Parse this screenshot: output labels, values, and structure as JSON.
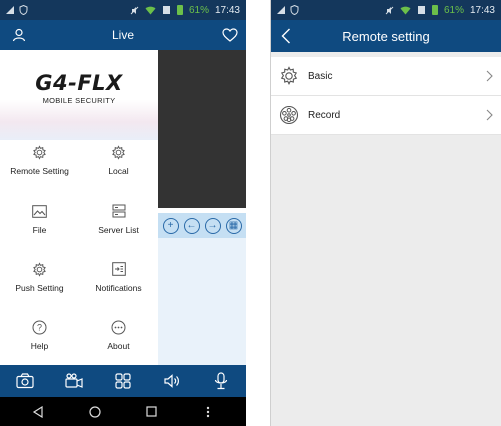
{
  "left_screen": {
    "status_bar": {
      "battery": "61%",
      "time": "17:43"
    },
    "app_bar": {
      "title": "Live",
      "left_icon": "user-icon",
      "right_icon": "heart-icon"
    },
    "drawer": {
      "logo": "G4-FLX",
      "logo_subtitle": "MOBILE SECURITY",
      "items": [
        {
          "label": "Remote Setting",
          "icon": "gear-icon"
        },
        {
          "label": "Local",
          "icon": "gear-icon"
        },
        {
          "label": "File",
          "icon": "image-icon"
        },
        {
          "label": "Server List",
          "icon": "server-icon"
        },
        {
          "label": "Push Setting",
          "icon": "gear-icon"
        },
        {
          "label": "Notifications",
          "icon": "notifications-icon"
        },
        {
          "label": "Help",
          "icon": "help-icon"
        },
        {
          "label": "About",
          "icon": "more-icon"
        }
      ]
    },
    "ptz_controls": [
      "zoom-in-icon",
      "arrow-left-icon",
      "arrow-right-icon",
      "grid-icon"
    ],
    "bottom_toolbar": [
      "camera-icon",
      "video-record-icon",
      "layout-grid-icon",
      "speaker-icon",
      "microphone-icon"
    ],
    "nav_bar": [
      "back-icon",
      "home-icon",
      "recents-icon",
      "menu-icon"
    ]
  },
  "right_screen": {
    "status_bar": {
      "battery": "61%",
      "time": "17:43"
    },
    "app_bar": {
      "title": "Remote setting"
    },
    "rows": [
      {
        "label": "Basic",
        "icon": "gear-icon"
      },
      {
        "label": "Record",
        "icon": "film-reel-icon"
      }
    ]
  },
  "colors": {
    "primary": "#0f4a80",
    "status_bar": "#14375c",
    "battery_green": "#6cc04a",
    "video_bg": "#333333",
    "ptz_bg": "#c5dff3",
    "settings_bg": "#ececec"
  }
}
